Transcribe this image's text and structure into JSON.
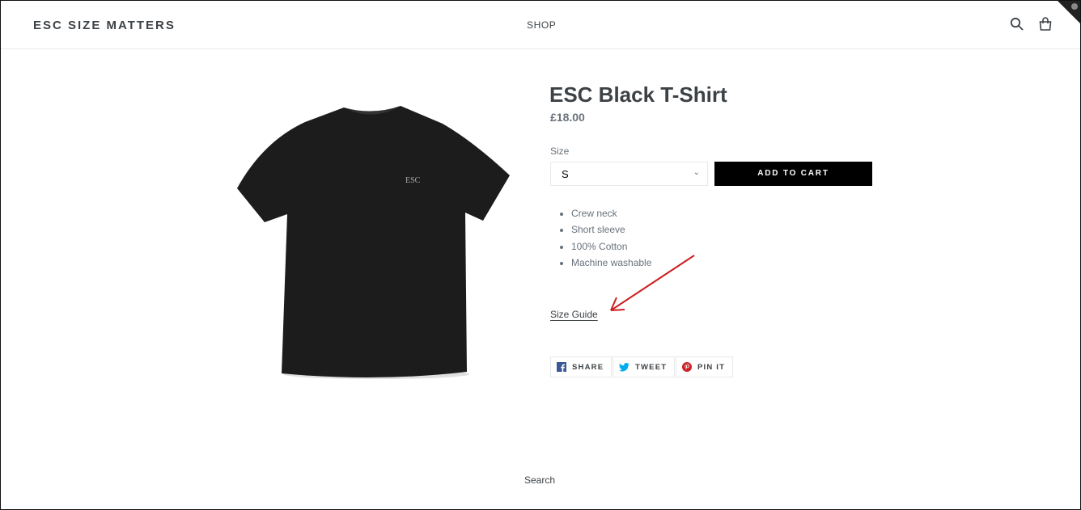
{
  "header": {
    "logo": "ESC SIZE MATTERS",
    "nav": [
      {
        "label": "SHOP"
      }
    ],
    "icons": [
      "search-icon",
      "shopping-bag-icon"
    ]
  },
  "product": {
    "title": "ESC Black T-Shirt",
    "price": "£18.00",
    "image_print": "ESC",
    "size_label": "Size",
    "size_selected": "S",
    "add_to_cart": "ADD TO CART",
    "features": [
      "Crew neck",
      "Short sleeve",
      "100% Cotton",
      "Machine washable"
    ],
    "size_guide": "Size Guide",
    "share": [
      {
        "label": "SHARE",
        "icon": "facebook-icon",
        "color": "#3b5998"
      },
      {
        "label": "TWEET",
        "icon": "twitter-icon",
        "color": "#00aced"
      },
      {
        "label": "PIN IT",
        "icon": "pinterest-icon",
        "color": "#cb2027"
      }
    ]
  },
  "footer": {
    "link": "Search"
  },
  "annotation_color": "#cc1f1f"
}
